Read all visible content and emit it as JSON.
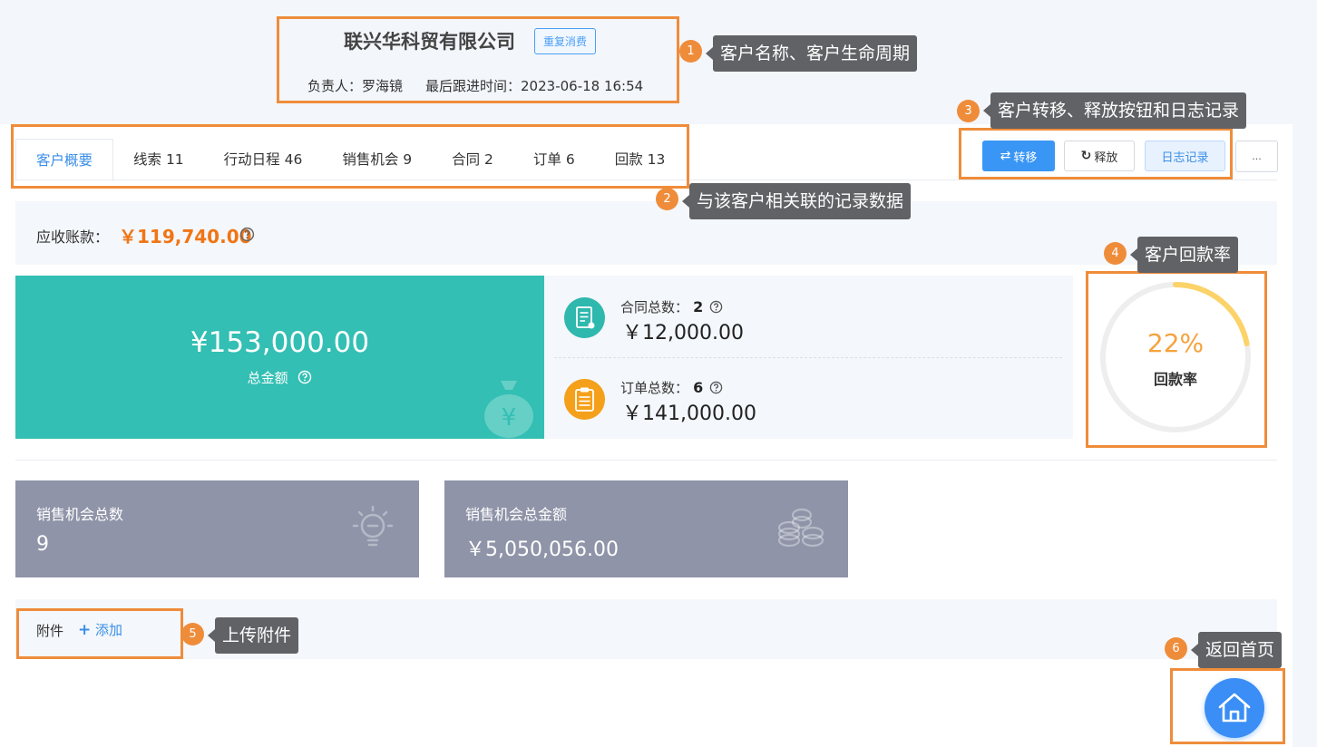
{
  "header": {
    "company_name": "联兴华科贸有限公司",
    "lifecycle_badge": "重复消费",
    "owner_label": "负责人：",
    "owner": "罗海镜",
    "last_follow_label": "最后跟进时间：",
    "last_follow_time": "2023-06-18 16:54"
  },
  "tabs": [
    {
      "label": "客户概要"
    },
    {
      "label": "线索 11"
    },
    {
      "label": "行动日程 46"
    },
    {
      "label": "销售机会 9"
    },
    {
      "label": "合同 2"
    },
    {
      "label": "订单 6"
    },
    {
      "label": "回款 13"
    }
  ],
  "actions": {
    "transfer": "转移",
    "release": "释放",
    "log": "日志记录",
    "more": "..."
  },
  "receivable": {
    "label": "应收账款：",
    "value": "￥119,740.00"
  },
  "total": {
    "amount": "¥153,000.00",
    "label": "总金额"
  },
  "contracts": {
    "label": "合同总数：",
    "count": "2",
    "amount": "￥12,000.00"
  },
  "orders": {
    "label": "订单总数：",
    "count": "6",
    "amount": "￥141,000.00"
  },
  "payback": {
    "percent_text": "22%",
    "percent": 22,
    "label": "回款率"
  },
  "opportunity_count": {
    "title": "销售机会总数",
    "value": "9"
  },
  "opportunity_amount": {
    "title": "销售机会总金额",
    "value": "￥5,050,056.00"
  },
  "attachment": {
    "label": "附件",
    "add": "添加"
  },
  "callouts": [
    {
      "num": "1",
      "text": "客户名称、客户生命周期"
    },
    {
      "num": "2",
      "text": "与该客户相关联的记录数据"
    },
    {
      "num": "3",
      "text": "客户转移、释放按钮和日志记录"
    },
    {
      "num": "4",
      "text": "客户回款率"
    },
    {
      "num": "5",
      "text": "上传附件"
    },
    {
      "num": "6",
      "text": "返回首页"
    }
  ],
  "colors": {
    "accent": "#3a8ee6",
    "teal": "#33bfb3",
    "orange": "#f07514",
    "callout": "#ef8c3a",
    "gray_card": "#8f94a8"
  }
}
